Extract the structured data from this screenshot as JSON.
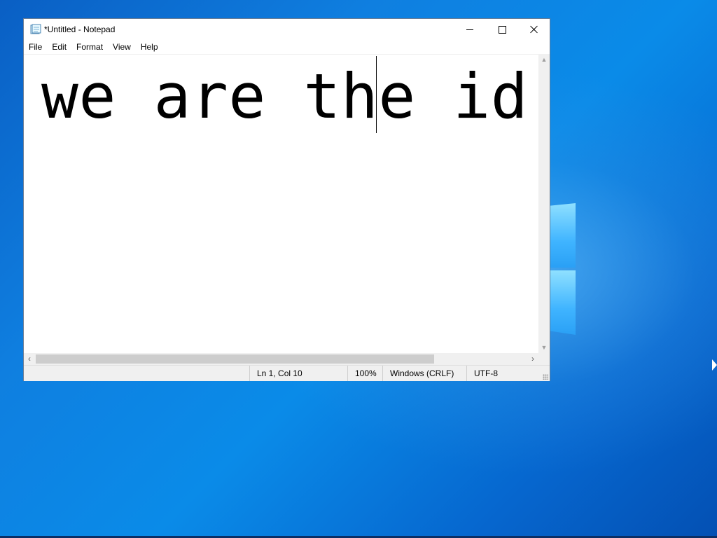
{
  "window": {
    "title": "*Untitled - Notepad",
    "icon": "notepad-icon"
  },
  "menu": {
    "items": [
      "File",
      "Edit",
      "Format",
      "View",
      "Help"
    ]
  },
  "editor": {
    "text": "we are the id"
  },
  "status": {
    "position": "Ln 1, Col 10",
    "zoom": "100%",
    "line_ending": "Windows (CRLF)",
    "encoding": "UTF-8"
  },
  "colors": {
    "desktop": "#0a7fe0",
    "window_bg": "#ffffff",
    "statusbar_bg": "#f0f0f0"
  }
}
